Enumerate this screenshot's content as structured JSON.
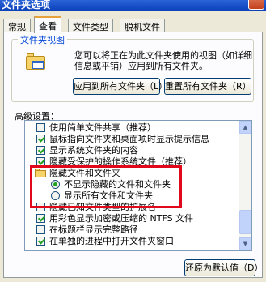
{
  "window": {
    "title": "文件夹选项"
  },
  "tabs": [
    {
      "label": "常规"
    },
    {
      "label": "查看"
    },
    {
      "label": "文件类型"
    },
    {
      "label": "脱机文件"
    }
  ],
  "folder_views": {
    "legend": "文件夹视图",
    "description_line1": "您可以将正在为此文件夹使用的视图（如详细",
    "description_line2": "信息或平铺）应用到所有文件夹。",
    "apply_all_label": "应用到所有文件夹（L）",
    "reset_all_label": "重置所有文件夹（R）"
  },
  "advanced": {
    "label": "高级设置：",
    "items": [
      {
        "text": "使用简单文件共享（推荐）",
        "checked": false
      },
      {
        "text": "鼠标指向文件夹和桌面项时显示提示信息",
        "checked": true
      },
      {
        "text": "显示系统文件夹的内容",
        "checked": true
      },
      {
        "text": "隐藏受保护的操作系统文件（推荐）",
        "checked": true
      },
      {
        "text": "隐藏文件和文件夹"
      },
      {
        "text": "不显示隐藏的文件和文件夹",
        "selected": true
      },
      {
        "text": "显示所有文件和文件夹",
        "selected": false
      },
      {
        "text": "隐藏已知文件类型的扩展名",
        "checked": false
      },
      {
        "text": "用彩色显示加密或压缩的 NTFS 文件",
        "checked": true
      },
      {
        "text": "在标题栏显示完整路径",
        "checked": false
      },
      {
        "text": "在单独的进程中打开文件夹窗口",
        "checked": true
      }
    ]
  },
  "restore_defaults_label": "还原为默认值（D）",
  "colors": {
    "highlight_border": "#e2081c",
    "check_green": "#21a121"
  }
}
